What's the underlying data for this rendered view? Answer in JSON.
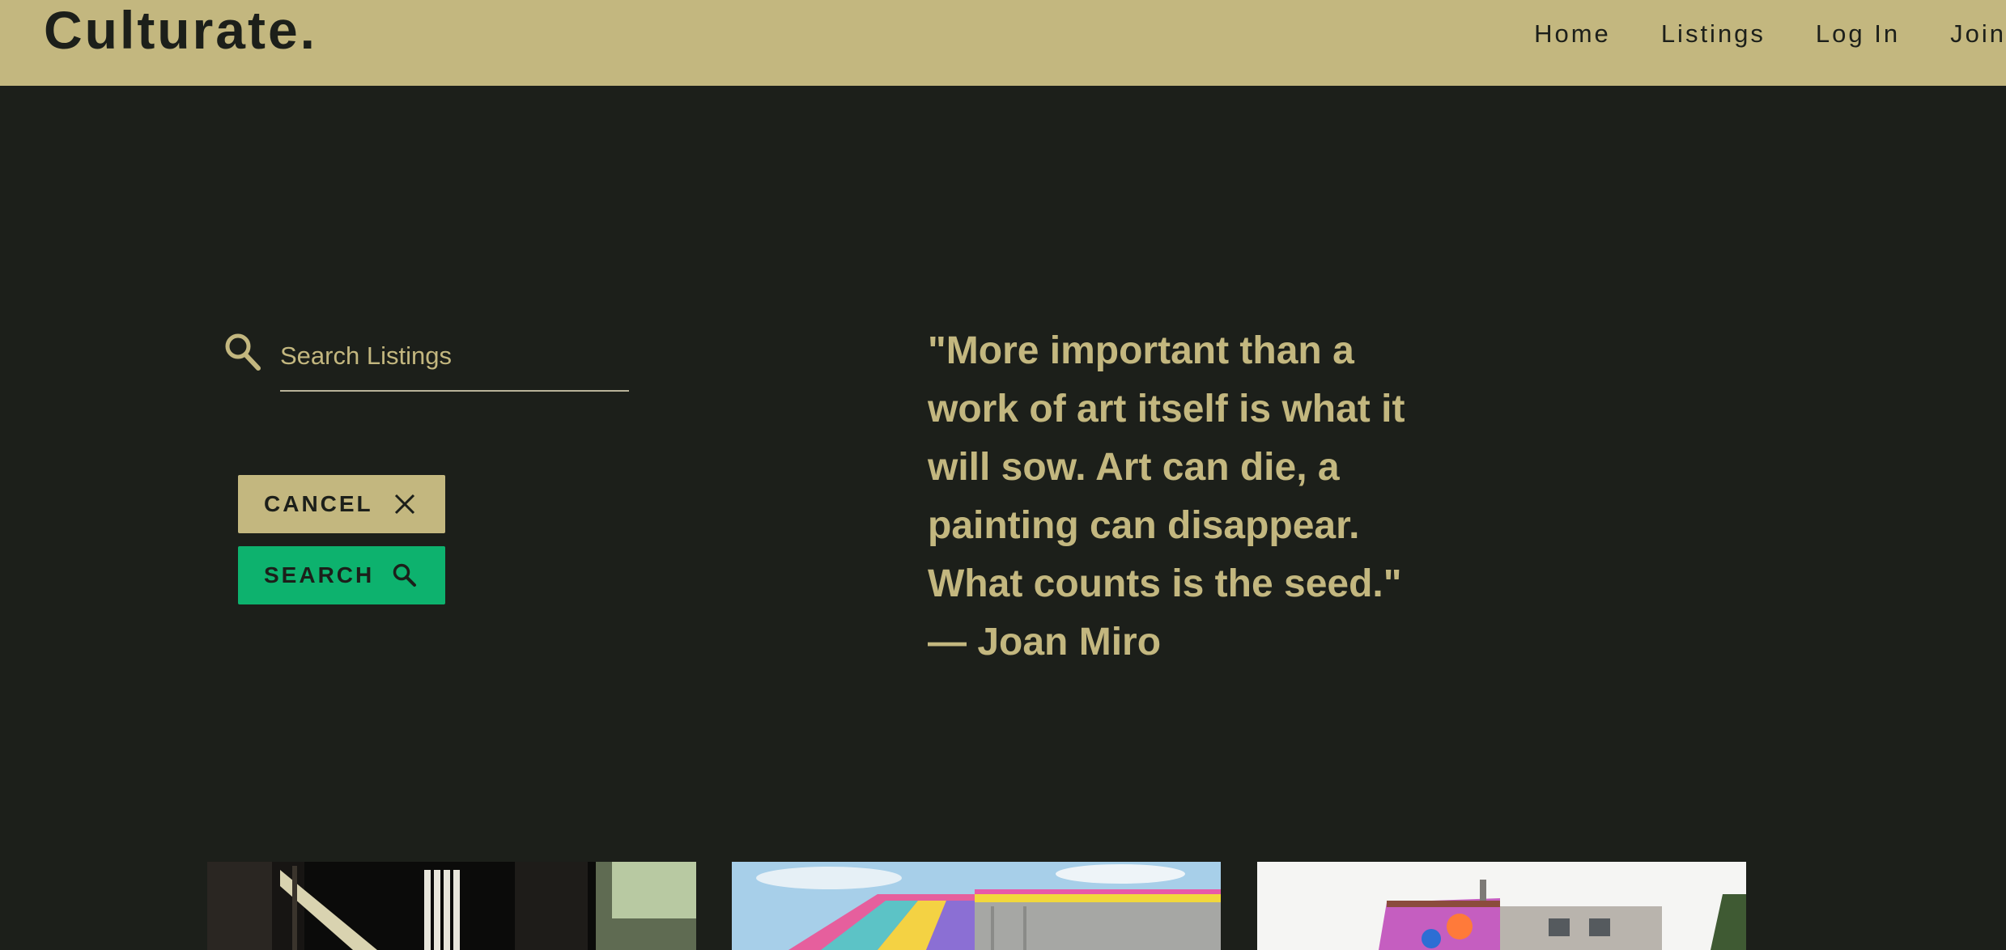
{
  "header": {
    "brand": "Culturate.",
    "nav": [
      "Home",
      "Listings",
      "Log In",
      "Join"
    ]
  },
  "search": {
    "placeholder": "Search Listings",
    "value": "",
    "cancel_label": "CANCEL",
    "search_label": "SEARCH"
  },
  "quote": {
    "text": "\"More important than a work of art itself is what it will sow. Art can die, a painting can disappear. What counts is the seed.\"",
    "author": "— Joan Miro"
  },
  "cards": [
    {
      "image": "gallery-hallway-photo"
    },
    {
      "image": "colorful-tent-building-photo"
    },
    {
      "image": "mural-building-photo"
    }
  ],
  "colors": {
    "header_bg": "#c3b77f",
    "page_bg": "#1c1f1a",
    "accent_gold": "#c3b77f",
    "search_green": "#0db26e"
  }
}
